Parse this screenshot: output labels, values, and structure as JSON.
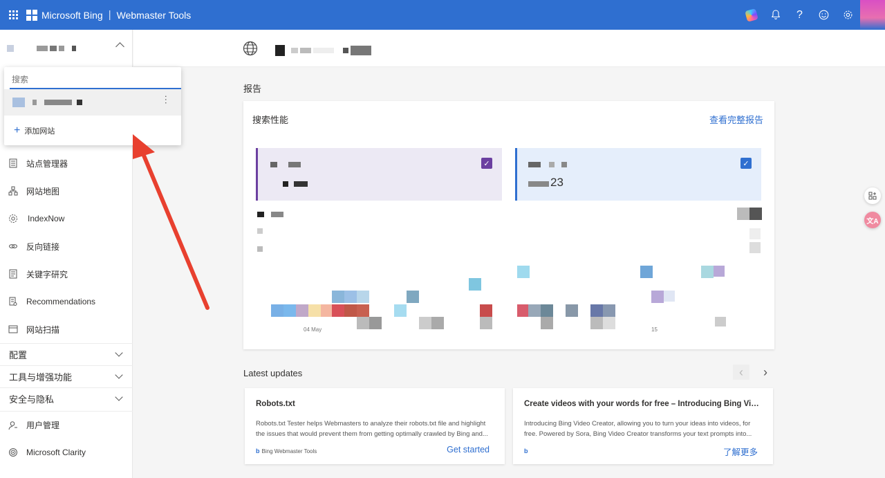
{
  "topbar": {
    "brand": "Microsoft Bing",
    "product": "Webmaster Tools",
    "icons": [
      "app-launcher-icon",
      "copilot-icon",
      "bell-icon",
      "help-icon",
      "feedback-smiley-icon",
      "gear-icon"
    ]
  },
  "dropdown": {
    "search_placeholder": "搜索",
    "add_site_label": "添加网站"
  },
  "sidebar": {
    "items": [
      {
        "label": "站点管理器",
        "icon": "site-manager-icon"
      },
      {
        "label": "网站地图",
        "icon": "sitemap-icon"
      },
      {
        "label": "IndexNow",
        "icon": "indexnow-icon"
      },
      {
        "label": "反向链接",
        "icon": "backlinks-icon"
      },
      {
        "label": "关键字研究",
        "icon": "keyword-research-icon"
      },
      {
        "label": "Recommendations",
        "icon": "recommendations-icon"
      },
      {
        "label": "网站扫描",
        "icon": "site-scan-icon"
      }
    ],
    "groups": [
      {
        "label": "配置"
      },
      {
        "label": "工具与增强功能"
      },
      {
        "label": "安全与隐私"
      }
    ],
    "bottom_items": [
      {
        "label": "用户管理",
        "icon": "user-management-icon"
      },
      {
        "label": "Microsoft Clarity",
        "icon": "clarity-icon"
      }
    ]
  },
  "main": {
    "reports_title": "报告",
    "search_performance": {
      "title": "搜索性能",
      "view_full_report": "查看完整报告",
      "impressions_value_visible": "23",
      "x_labels": [
        "04 May",
        "15"
      ]
    },
    "latest_updates": {
      "title": "Latest updates",
      "cards": [
        {
          "title": "Robots.txt",
          "body": "Robots.txt Tester helps Webmasters to analyze their robots.txt file and highlight the issues that would prevent them from getting optimally crawled by Bing and...",
          "source": "Bing Webmaster Tools",
          "cta": "Get started"
        },
        {
          "title": "Create videos with your words for free – Introducing Bing Video C...",
          "body": "Introducing Bing Video Creator, allowing you to turn your ideas into videos, for free. Powered by Sora, Bing Video Creator transforms your text prompts into...",
          "source": "",
          "cta": "了解更多"
        }
      ]
    }
  },
  "floating": {
    "translate_label": "文A"
  },
  "colors": {
    "brand_blue": "#2f6fd0",
    "clicks_purple": "#6b3fa0",
    "annotation_red": "#e8402f"
  }
}
